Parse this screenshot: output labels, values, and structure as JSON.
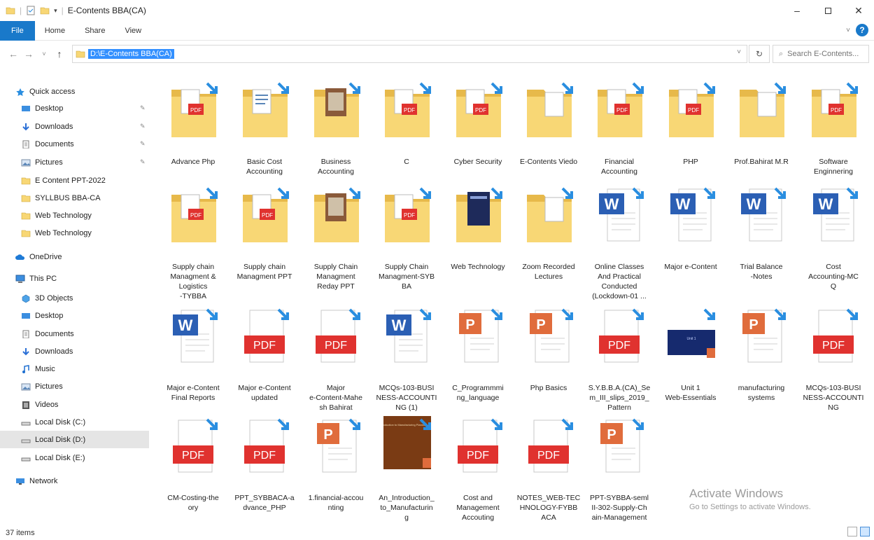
{
  "window": {
    "title": "E-Contents BBA(CA)"
  },
  "ribbon": {
    "tabs": [
      "File",
      "Home",
      "Share",
      "View"
    ]
  },
  "address": {
    "path": "D:\\E-Contents BBA(CA)"
  },
  "search": {
    "placeholder": "Search E-Contents..."
  },
  "sidebar": {
    "items": [
      {
        "label": "Quick access",
        "icon": "star-icon"
      },
      {
        "label": "Desktop",
        "icon": "desktop-icon",
        "pinned": true
      },
      {
        "label": "Downloads",
        "icon": "download-icon",
        "pinned": true
      },
      {
        "label": "Documents",
        "icon": "documents-icon",
        "pinned": true
      },
      {
        "label": "Pictures",
        "icon": "pictures-icon",
        "pinned": true
      },
      {
        "label": "E Content PPT-2022",
        "icon": "folder-icon"
      },
      {
        "label": "SYLLBUS BBA-CA",
        "icon": "folder-icon"
      },
      {
        "label": "Web Technology",
        "icon": "folder-icon"
      },
      {
        "label": "Web Technology",
        "icon": "folder-icon"
      },
      {
        "label": "OneDrive",
        "icon": "cloud-icon"
      },
      {
        "label": "This PC",
        "icon": "computer-icon"
      },
      {
        "label": "3D Objects",
        "icon": "cube-icon"
      },
      {
        "label": "Desktop",
        "icon": "desktop-icon"
      },
      {
        "label": "Documents",
        "icon": "documents-icon"
      },
      {
        "label": "Downloads",
        "icon": "download-icon"
      },
      {
        "label": "Music",
        "icon": "music-icon"
      },
      {
        "label": "Pictures",
        "icon": "pictures-icon"
      },
      {
        "label": "Videos",
        "icon": "videos-icon"
      },
      {
        "label": "Local Disk (C:)",
        "icon": "drive-icon"
      },
      {
        "label": "Local Disk (D:)",
        "icon": "drive-icon",
        "selected": true
      },
      {
        "label": "Local Disk (E:)",
        "icon": "drive-icon"
      },
      {
        "label": "Network",
        "icon": "network-icon"
      }
    ]
  },
  "files": [
    {
      "name": "Advance Php",
      "type": "folder-pdf"
    },
    {
      "name": "Basic Cost Accounting",
      "type": "folder-doc"
    },
    {
      "name": "Business Accounting",
      "type": "folder-mixed"
    },
    {
      "name": "C",
      "type": "folder-pdf"
    },
    {
      "name": "Cyber Security",
      "type": "folder-pdf"
    },
    {
      "name": "E-Contents Viedo",
      "type": "folder"
    },
    {
      "name": "Financial Accounting",
      "type": "folder-pdf"
    },
    {
      "name": "PHP",
      "type": "folder-pdf"
    },
    {
      "name": "Prof.Bahirat M.R",
      "type": "folder"
    },
    {
      "name": "Software Enginnering",
      "type": "folder-pdf"
    },
    {
      "name": "Supply chain Managment & Logistics -TYBBA",
      "type": "folder-pdf"
    },
    {
      "name": "Supply chain Managment PPT",
      "type": "folder-pdf"
    },
    {
      "name": "Supply Chain Managment Reday PPT",
      "type": "folder-mixed"
    },
    {
      "name": "Supply Chain Managment-SYBBA",
      "type": "folder-pdf"
    },
    {
      "name": "Web Technology",
      "type": "folder-dark"
    },
    {
      "name": "Zoom Recorded Lectures",
      "type": "folder"
    },
    {
      "name": "Online Classes And Practical Conducted (Lockdown-01 ...",
      "type": "word"
    },
    {
      "name": "Major e-Content",
      "type": "word"
    },
    {
      "name": "Trial Balance -Notes",
      "type": "word"
    },
    {
      "name": "Cost Accounting-MCQ",
      "type": "word"
    },
    {
      "name": "Major e-Content Final Reports",
      "type": "word"
    },
    {
      "name": "Major e-Content updated",
      "type": "pdf"
    },
    {
      "name": "Major e-Content-Mahesh Bahirat",
      "type": "pdf"
    },
    {
      "name": "MCQs-103-BUSINESS-ACCOUNTING (1)",
      "type": "word"
    },
    {
      "name": "C_Programmming_language",
      "type": "ppt"
    },
    {
      "name": "Php Basics",
      "type": "ppt"
    },
    {
      "name": "S.Y.B.B.A.(CA)_Sem_III_slips_2019_Pattern",
      "type": "pdf"
    },
    {
      "name": "Unit 1 Web-Essentials",
      "type": "ppt-thumb-blue"
    },
    {
      "name": "manufacturing systems",
      "type": "ppt"
    },
    {
      "name": "MCQs-103-BUSINESS-ACCOUNTING",
      "type": "pdf"
    },
    {
      "name": "CM-Costing-theory",
      "type": "pdf"
    },
    {
      "name": "PPT_SYBBACA-advance_PHP",
      "type": "pdf"
    },
    {
      "name": "1.financial-accounting",
      "type": "ppt"
    },
    {
      "name": "An_Introduction_to_Manufacturing",
      "type": "ppt-thumb-brown"
    },
    {
      "name": "Cost and Management Accouting",
      "type": "pdf"
    },
    {
      "name": "NOTES_WEB-TECHNOLOGY-FYBBACA",
      "type": "pdf"
    },
    {
      "name": "PPT-SYBBA-semIII-302-Supply-Chain-Management",
      "type": "ppt"
    }
  ],
  "file_labels": [
    [
      "Advance Php"
    ],
    [
      "Basic Cost",
      "Accounting"
    ],
    [
      "Business",
      "Accounting"
    ],
    [
      "C"
    ],
    [
      "Cyber Security"
    ],
    [
      "E-Contents Viedo"
    ],
    [
      "Financial",
      "Accounting"
    ],
    [
      "PHP"
    ],
    [
      "Prof.Bahirat M.R"
    ],
    [
      "Software",
      "Enginnering"
    ],
    [
      "Supply chain",
      "Managment &",
      "Logistics",
      "-TYBBA"
    ],
    [
      "Supply chain",
      "Managment PPT"
    ],
    [
      "Supply Chain",
      "Managment",
      "Reday PPT"
    ],
    [
      "Supply Chain",
      "Managment-SYB",
      "BA"
    ],
    [
      "Web Technology"
    ],
    [
      "Zoom Recorded",
      "Lectures"
    ],
    [
      "Online Classes",
      "And Practical",
      "Conducted",
      "(Lockdown-01 ..."
    ],
    [
      "Major e-Content"
    ],
    [
      "Trial Balance",
      "-Notes"
    ],
    [
      "Cost",
      "Accounting-MC",
      "Q"
    ],
    [
      "Major e-Content",
      "Final Reports"
    ],
    [
      "Major e-Content",
      "updated"
    ],
    [
      "Major",
      "e-Content-Mahe",
      "sh Bahirat"
    ],
    [
      "MCQs-103-BUSI",
      "NESS-ACCOUNTI",
      "NG (1)"
    ],
    [
      "C_Programmmi",
      "ng_language"
    ],
    [
      "Php Basics"
    ],
    [
      "S.Y.B.B.A.(CA)_Se",
      "m_III_slips_2019_",
      "Pattern"
    ],
    [
      "Unit 1",
      "Web-Essentials"
    ],
    [
      "manufacturing",
      "systems"
    ],
    [
      "MCQs-103-BUSI",
      "NESS-ACCOUNTI",
      "NG"
    ],
    [
      "CM-Costing-the",
      "ory"
    ],
    [
      "PPT_SYBBACA-a",
      "dvance_PHP"
    ],
    [
      "1.financial-accou",
      "nting"
    ],
    [
      "An_Introduction_",
      "to_Manufacturin",
      "g"
    ],
    [
      "Cost and",
      "Management",
      "Accouting"
    ],
    [
      "NOTES_WEB-TEC",
      "HNOLOGY-FYBB",
      "ACA"
    ],
    [
      "PPT-SYBBA-seml",
      "II-302-Supply-Ch",
      "ain-Management"
    ]
  ],
  "thumb_texts": {
    "pdf": "PDF",
    "word": "W",
    "ppt": "P",
    "unit1": "Unit 1",
    "intro": "An Introduction to Manufacturing Planning & Control"
  },
  "status": {
    "count": "37 items"
  },
  "watermark": {
    "line1": "Activate Windows",
    "line2": "Go to Settings to activate Windows."
  },
  "colors": {
    "accent": "#1979ca",
    "folder": "#f8d775",
    "pdf_red": "#e0322f",
    "word_blue": "#2b5fb4",
    "ppt_orange": "#e06c3c",
    "shortcut_arrow": "#2a8ee0"
  }
}
